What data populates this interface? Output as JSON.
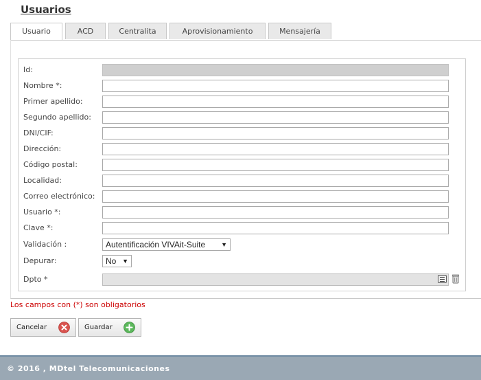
{
  "page": {
    "title": "Usuarios"
  },
  "tabs": [
    {
      "label": "Usuario",
      "active": true
    },
    {
      "label": "ACD"
    },
    {
      "label": "Centralita"
    },
    {
      "label": "Aprovisionamiento"
    },
    {
      "label": "Mensajería"
    }
  ],
  "form": {
    "id_label": "Id:",
    "nombre_label": "Nombre *:",
    "primer_apellido_label": "Primer apellido:",
    "segundo_apellido_label": "Segundo apellido:",
    "dni_label": "DNI/CIF:",
    "direccion_label": "Dirección:",
    "codigo_postal_label": "Código postal:",
    "localidad_label": "Localidad:",
    "correo_label": "Correo electrónico:",
    "usuario_label": "Usuario *:",
    "clave_label": "Clave *:",
    "validacion_label": "Validación :",
    "validacion_value": "Autentificación VIVAit-Suite",
    "depurar_label": "Depurar:",
    "depurar_value": "No",
    "dpto_label": "Dpto *"
  },
  "icons": {
    "select_arrow": "▼",
    "list": "list-icon",
    "trash": "trash-icon",
    "cancel": "cancel-icon",
    "save": "add-icon"
  },
  "notes": {
    "required": "Los campos con (*) son obligatorios"
  },
  "buttons": {
    "cancel": "Cancelar",
    "save": "Guardar"
  },
  "footer": {
    "text": "© 2016 , MDtel Telecomunicaciones"
  },
  "colors": {
    "required": "#cc0000",
    "footer_bg": "#9aa8b4",
    "cancel_icon": "#d9534f",
    "save_icon": "#5cb85c"
  }
}
